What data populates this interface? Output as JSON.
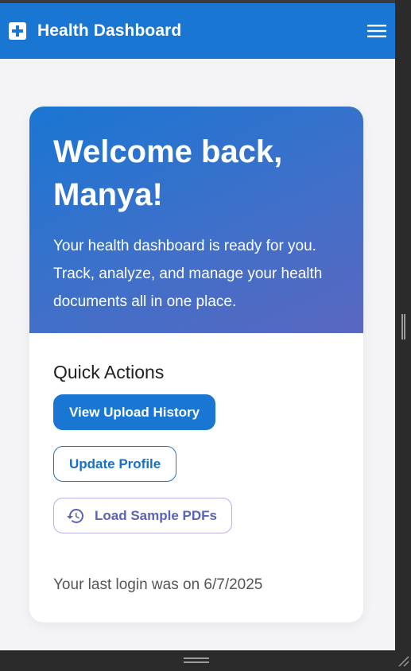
{
  "header": {
    "title": "Health Dashboard",
    "logo_icon": "medical-cross-icon",
    "menu_icon": "hamburger-menu-icon"
  },
  "welcome": {
    "title": "Welcome back, Manya!",
    "text": "Your health dashboard is ready for you. Track, analyze, and manage your health documents all in one place."
  },
  "quick_actions": {
    "title": "Quick Actions",
    "view_history_label": "View Upload History",
    "update_profile_label": "Update Profile",
    "load_samples_label": "Load Sample PDFs",
    "load_samples_icon": "history-icon"
  },
  "last_login": "Your last login was on 6/7/2025",
  "colors": {
    "primary": "#1976d2",
    "gradient_end": "#5a67c0",
    "accent_purple": "#5b63b7"
  }
}
